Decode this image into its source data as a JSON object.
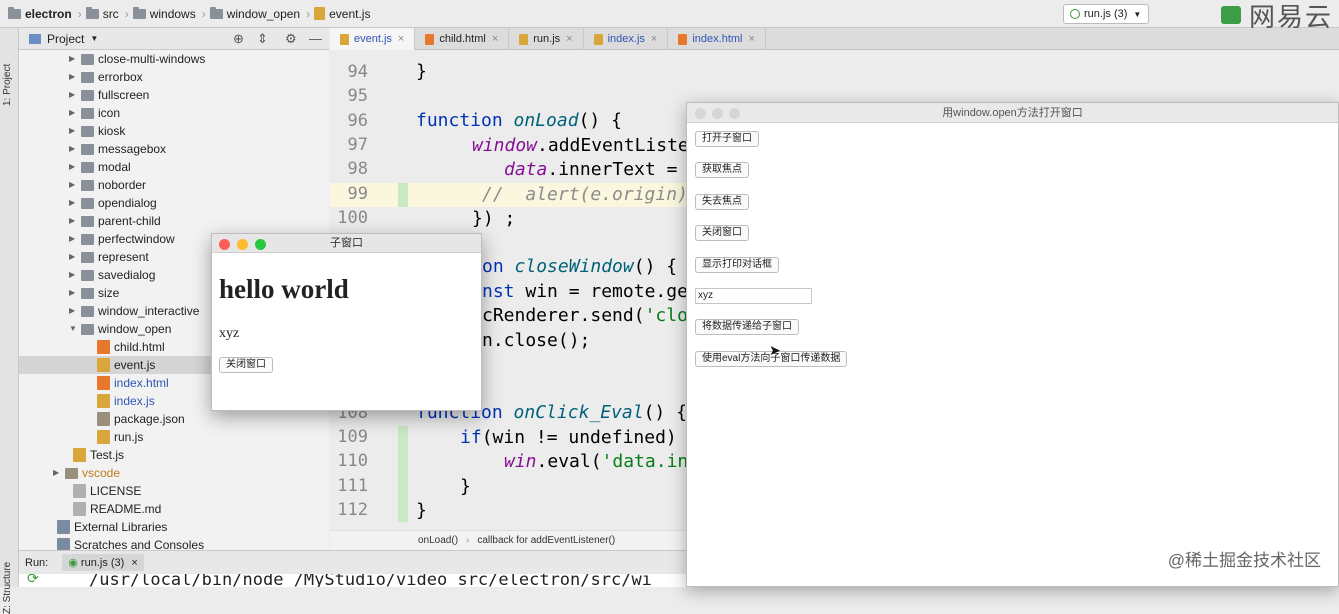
{
  "breadcrumb": [
    "electron",
    "src",
    "windows",
    "window_open",
    "event.js"
  ],
  "run_config": "run.js (3)",
  "watermark_top": "网易云",
  "watermark_bottom": "@稀土掘金技术社区",
  "left_strip": {
    "project": "1: Project",
    "structure": "Z: Structure"
  },
  "project_panel": {
    "title": "Project"
  },
  "tree": [
    {
      "label": "close-multi-windows",
      "type": "folder",
      "depth": 1,
      "expanded": false
    },
    {
      "label": "errorbox",
      "type": "folder",
      "depth": 1,
      "expanded": false
    },
    {
      "label": "fullscreen",
      "type": "folder",
      "depth": 1,
      "expanded": false
    },
    {
      "label": "icon",
      "type": "folder",
      "depth": 1,
      "expanded": false
    },
    {
      "label": "kiosk",
      "type": "folder",
      "depth": 1,
      "expanded": false
    },
    {
      "label": "messagebox",
      "type": "folder",
      "depth": 1,
      "expanded": false
    },
    {
      "label": "modal",
      "type": "folder",
      "depth": 1,
      "expanded": false
    },
    {
      "label": "noborder",
      "type": "folder",
      "depth": 1,
      "expanded": false
    },
    {
      "label": "opendialog",
      "type": "folder",
      "depth": 1,
      "expanded": false
    },
    {
      "label": "parent-child",
      "type": "folder",
      "depth": 1,
      "expanded": false
    },
    {
      "label": "perfectwindow",
      "type": "folder",
      "depth": 1,
      "expanded": false
    },
    {
      "label": "represent",
      "type": "folder",
      "depth": 1,
      "expanded": false
    },
    {
      "label": "savedialog",
      "type": "folder",
      "depth": 1,
      "expanded": false
    },
    {
      "label": "size",
      "type": "folder",
      "depth": 1,
      "expanded": false
    },
    {
      "label": "window_interactive",
      "type": "folder",
      "depth": 1,
      "expanded": false
    },
    {
      "label": "window_open",
      "type": "folder",
      "depth": 1,
      "expanded": true
    },
    {
      "label": "child.html",
      "type": "html",
      "depth": 2
    },
    {
      "label": "event.js",
      "type": "js",
      "depth": 2,
      "selected": true
    },
    {
      "label": "index.html",
      "type": "html",
      "depth": 2,
      "blue": true
    },
    {
      "label": "index.js",
      "type": "js",
      "depth": 2,
      "blue": true
    },
    {
      "label": "package.json",
      "type": "json",
      "depth": 2
    },
    {
      "label": "run.js",
      "type": "js",
      "depth": 2
    },
    {
      "label": "Test.js",
      "type": "js",
      "depth": 0.5
    },
    {
      "label": "vscode",
      "type": "folder",
      "depth": 0,
      "expanded": false,
      "orange": true
    },
    {
      "label": "LICENSE",
      "type": "file",
      "depth": 0.5
    },
    {
      "label": "README.md",
      "type": "file",
      "depth": 0.5
    },
    {
      "label": "External Libraries",
      "type": "lib",
      "depth": -0.5
    },
    {
      "label": "Scratches and Consoles",
      "type": "lib",
      "depth": -0.5
    }
  ],
  "tabs": [
    {
      "label": "event.js",
      "active": true
    },
    {
      "label": "child.html"
    },
    {
      "label": "run.js"
    },
    {
      "label": "index.js"
    },
    {
      "label": "index.html"
    }
  ],
  "line_numbers": [
    "94",
    "95",
    "96",
    "97",
    "98",
    "99",
    "100",
    "108",
    "109",
    "110",
    "111",
    "112"
  ],
  "code": {
    "l94": "}",
    "l96_kw": "function ",
    "l96_fn": "onLoad",
    "l96_rest": "() {",
    "l97_obj": "window",
    "l97_rest": ".addEventListe",
    "l98_obj": "data",
    "l98_rest": ".innerText =",
    "l99": "//  alert(e.origin)",
    "l100": "}) ;",
    "lc1_kw": "on ",
    "lc1_fn": "closeWindow",
    "lc1_rest": "() {",
    "lc2_kw": "nst ",
    "lc2_rest": "win = remote.ge",
    "lc3_rest": "cRenderer.send(",
    "lc3_str": "'clo",
    "lc4": "n.close();",
    "l108_kw": "function ",
    "l108_fn": "onClick_Eval",
    "l108_rest": "() {",
    "l109_kw": "if",
    "l109_rest": "(win != undefined)",
    "l110_obj": "win",
    "l110_rest": ".eval(",
    "l110_str": "'data.in",
    "l111": "}",
    "l112": "}"
  },
  "editor_breadcrumb": [
    "onLoad()",
    "callback for addEventListener()"
  ],
  "run_panel": {
    "label": "Run:",
    "config": "run.js (3)",
    "output": "/usr/local/bin/node /MyStudio/video_src/electron/src/wi"
  },
  "main_window": {
    "title": "用window.open方法打开窗口",
    "buttons": {
      "open_child": "打开子窗口",
      "get_focus": "获取焦点",
      "lose_focus": "失去焦点",
      "close_window": "关闭窗口",
      "print_dialog": "显示打印对话框",
      "send_data": "将数据传递给子窗口",
      "eval_data": "使用eval方法向子窗口传递数据"
    },
    "input_value": "xyz"
  },
  "child_window": {
    "title": "子窗口",
    "heading": "hello world",
    "text": "xyz",
    "close_button": "关闭窗口"
  },
  "colors": {
    "accent_blue": "#0033b3",
    "close_dot": "#fc5f57",
    "min_dot": "#fdbc2e",
    "max_dot": "#28c840"
  }
}
